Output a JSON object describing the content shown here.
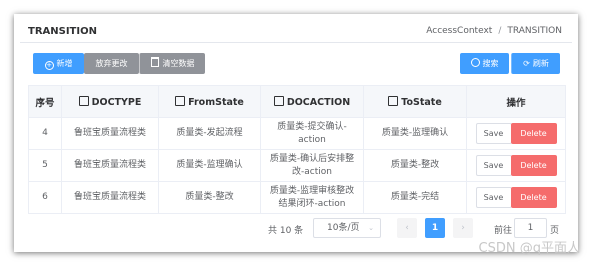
{
  "header": {
    "title": "TRANSITION",
    "crumb_context": "AccessContext",
    "crumb_sep": "/",
    "crumb_current": "TRANSITION"
  },
  "toolbar": {
    "new_label": "新增",
    "discard_label": "放弃更改",
    "clear_label": "清空数据",
    "search_label": "搜索",
    "refresh_label": "刷新"
  },
  "table": {
    "headers": {
      "seq": "序号",
      "doctype": "DOCTYPE",
      "from": "FromState",
      "docaction": "DOCACTION",
      "to": "ToState",
      "ops": "操作"
    },
    "rows": [
      {
        "seq": "4",
        "doctype": "鲁班宝质量流程类",
        "from": "质量类-发起流程",
        "docaction": "质量类-提交确认-action",
        "to": "质量类-监理确认"
      },
      {
        "seq": "5",
        "doctype": "鲁班宝质量流程类",
        "from": "质量类-监理确认",
        "docaction": "质量类-确认后安排整改-action",
        "to": "质量类-整改"
      },
      {
        "seq": "6",
        "doctype": "鲁班宝质量流程类",
        "from": "质量类-整改",
        "docaction": "质量类-监理审核整改结果闭环-action",
        "to": "质量类-完结"
      }
    ],
    "save_label": "Save",
    "delete_label": "Delete"
  },
  "pagination": {
    "total": "共 10 条",
    "page_size": "10条/页",
    "current_page": "1",
    "goto_label": "前往",
    "goto_value": "1",
    "page_suffix": "页"
  },
  "watermark": "CSDN @q平面人",
  "colors": {
    "primary": "#409eff",
    "gray": "#909399",
    "danger": "#f56c6c"
  }
}
